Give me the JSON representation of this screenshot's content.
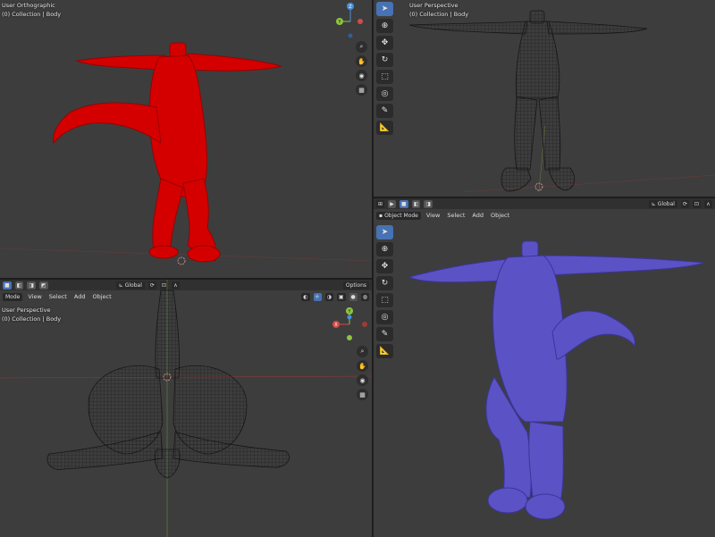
{
  "viewports": {
    "top_left": {
      "view_name": "User Orthographic",
      "collection": "(0) Collection | Body",
      "gizmo": {
        "y_label": "Y",
        "z_label": "Z"
      },
      "colors": {
        "body": "#d40000",
        "bg": "#3d3d3d"
      }
    },
    "top_right": {
      "view_name": "User Perspective",
      "collection": "(0) Collection | Body",
      "colors": {
        "wire": "#1a1a1a",
        "bg": "#3d3d3d"
      }
    },
    "bottom_right": {
      "view_name": "",
      "collection": "",
      "header": {
        "orientation": "Global",
        "mode": "Object Mode"
      },
      "menu": [
        "View",
        "Select",
        "Add",
        "Object"
      ],
      "colors": {
        "body": "#5b52c6",
        "bg": "#3d3d3d"
      }
    },
    "bottom_left": {
      "view_name": "User Perspective",
      "collection": "(0) Collection | Body",
      "header": {
        "orientation": "Global",
        "options": "Options",
        "mode": "Mode"
      },
      "menu": [
        "View",
        "Select",
        "Add",
        "Object"
      ],
      "gizmo": {
        "y_label": "Y",
        "x_label": "X"
      }
    }
  },
  "icons": {
    "select": "cursor-icon",
    "cursor": "crosshair-icon",
    "move": "move-icon",
    "rotate": "rotate-icon",
    "scale": "scale-icon",
    "transform": "transform-icon",
    "annotate": "annotate-icon",
    "measure": "measure-icon",
    "zoom": "zoom-icon",
    "pan": "hand-icon",
    "camera": "camera-icon",
    "grid": "grid-icon"
  },
  "accent": "#4772b3"
}
